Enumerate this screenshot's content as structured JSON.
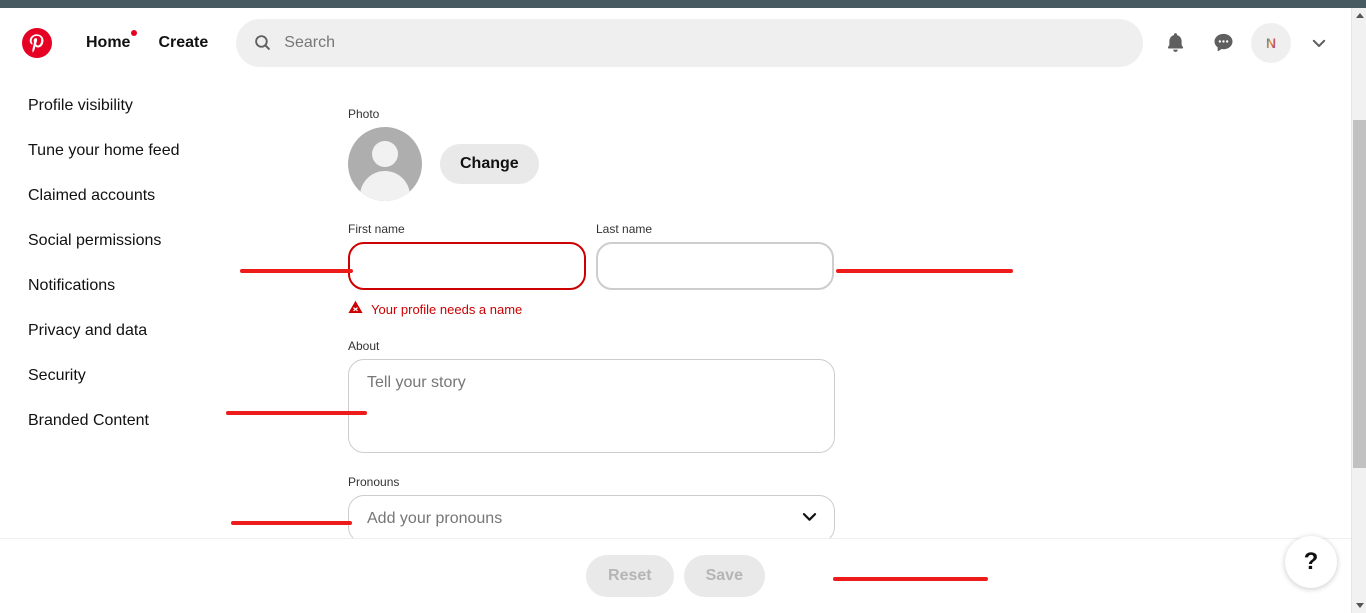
{
  "colors": {
    "brand_red": "#e60023",
    "error_red": "#cc0000",
    "annotation_red": "#ee1b1b",
    "chrome_bar": "#485a61",
    "field_border": "#cdcdcd",
    "pill_grey": "#e9e9e9"
  },
  "header": {
    "logo": "pinterest-logo-icon",
    "nav": [
      {
        "label": "Home",
        "has_dot": true
      },
      {
        "label": "Create",
        "has_dot": false
      }
    ],
    "search": {
      "placeholder": "Search",
      "value": "",
      "icon": "search-icon"
    },
    "actions": [
      {
        "name": "notifications-icon"
      },
      {
        "name": "messages-icon"
      }
    ],
    "avatar": {
      "letter": "N"
    },
    "account_chevron": "chevron-down-icon"
  },
  "sidebar": {
    "items": [
      {
        "label": "Profile visibility"
      },
      {
        "label": "Tune your home feed"
      },
      {
        "label": "Claimed accounts"
      },
      {
        "label": "Social permissions"
      },
      {
        "label": "Notifications"
      },
      {
        "label": "Privacy and data"
      },
      {
        "label": "Security"
      },
      {
        "label": "Branded Content"
      }
    ]
  },
  "form": {
    "photo": {
      "label": "Photo",
      "change_label": "Change",
      "avatar_icon": "person-placeholder-icon"
    },
    "first_name": {
      "label": "First name",
      "value": "",
      "placeholder": "",
      "has_error": true
    },
    "last_name": {
      "label": "Last name",
      "value": "",
      "placeholder": ""
    },
    "error": {
      "icon": "warning-triangle-icon",
      "text": "Your profile needs a name"
    },
    "about": {
      "label": "About",
      "value": "",
      "placeholder": "Tell your story"
    },
    "pronouns": {
      "label": "Pronouns",
      "value": "",
      "placeholder": "Add your pronouns",
      "chevron": "chevron-down-icon"
    }
  },
  "save_bar": {
    "reset_label": "Reset",
    "save_label": "Save",
    "disabled": true
  },
  "help": {
    "label": "?"
  },
  "scrollbar": {
    "up_arrow": "scroll-up-arrow-icon",
    "down_arrow": "scroll-down-arrow-icon"
  }
}
